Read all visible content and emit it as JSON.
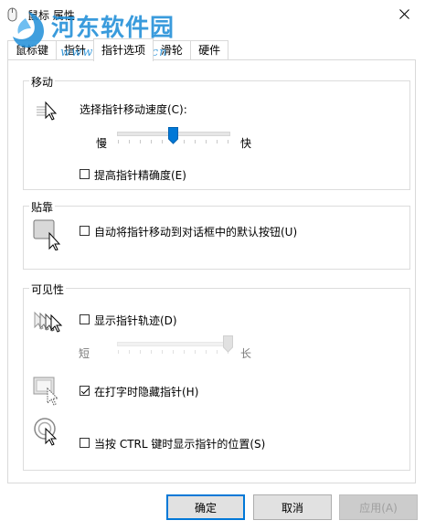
{
  "window": {
    "title": "鼠标 属性"
  },
  "watermark": {
    "name": "河东软件园",
    "url": "www.pc0359.cn"
  },
  "tabs": [
    {
      "label": "鼠标键"
    },
    {
      "label": "指针"
    },
    {
      "label": "指针选项"
    },
    {
      "label": "滑轮"
    },
    {
      "label": "硬件"
    }
  ],
  "motion": {
    "group_label": "移动",
    "speed_label": "选择指针移动速度(C):",
    "slow_label": "慢",
    "fast_label": "快",
    "speed_level": 0.5,
    "precision_label": "提高指针精确度(E)",
    "precision_checked": false
  },
  "snap": {
    "group_label": "贴靠",
    "snap_label": "自动将指针移动到对话框中的默认按钮(U)",
    "snap_checked": false
  },
  "visibility": {
    "group_label": "可见性",
    "trails_label": "显示指针轨迹(D)",
    "trails_checked": false,
    "short_label": "短",
    "long_label": "长",
    "trail_level": 1.0,
    "hide_label": "在打字时隐藏指针(H)",
    "hide_checked": true,
    "ctrl_label": "当按 CTRL 键时显示指针的位置(S)",
    "ctrl_checked": false
  },
  "buttons": {
    "ok": "确定",
    "cancel": "取消",
    "apply": "应用(A)"
  }
}
